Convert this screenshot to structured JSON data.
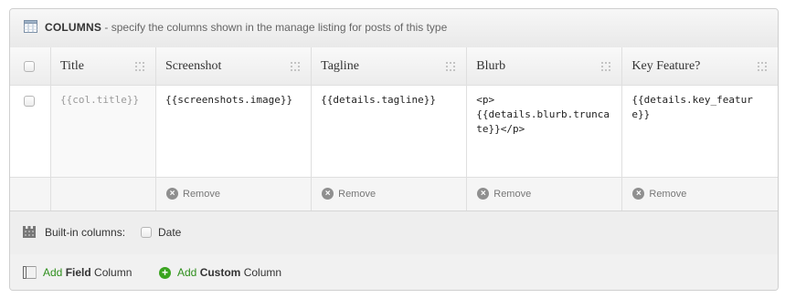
{
  "panel": {
    "title_bold": "COLUMNS",
    "title_desc": " - specify the columns shown in the manage listing for posts of this type",
    "icon": "table-icon"
  },
  "columns": [
    {
      "header": "Title",
      "value": "{{col.title}}",
      "muted": true
    },
    {
      "header": "Screenshot",
      "value": "{{screenshots.image}}",
      "muted": false
    },
    {
      "header": "Tagline",
      "value": "{{details.tagline}}",
      "muted": false
    },
    {
      "header": "Blurb",
      "value": "<p>\n{{details.blurb.truncate}}</p>",
      "muted": false
    },
    {
      "header": "Key Feature?",
      "value": "{{details.key_feature}}",
      "muted": false
    }
  ],
  "remove_label": "Remove",
  "builtin": {
    "label": "Built-in columns:",
    "options": [
      {
        "label": "Date",
        "checked": false
      }
    ]
  },
  "footer": {
    "add_field": {
      "prefix": "Add ",
      "bold": "Field",
      "suffix": " Column"
    },
    "add_custom": {
      "prefix": "Add ",
      "bold": "Custom",
      "suffix": " Column"
    }
  },
  "colors": {
    "accent_green": "#2f8f1d",
    "plus_green": "#3aa41f"
  }
}
